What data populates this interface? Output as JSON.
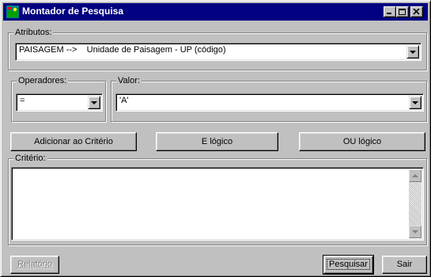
{
  "window": {
    "title": "Montador de Pesquisa",
    "app_icon": "map-search-icon",
    "controls": {
      "minimize": "minimize-icon",
      "maximize": "maximize-icon",
      "close": "close-icon"
    }
  },
  "atributos": {
    "label": "Atributos:",
    "value": "PAISAGEM -->    Unidade de Paisagem - UP (código)"
  },
  "operadores": {
    "label": "Operadores:",
    "value": "="
  },
  "valor": {
    "label": "Valor:",
    "value": "'A'"
  },
  "actions": {
    "add_label": "Adicionar ao Critério",
    "and_label": "E lógico",
    "or_label": "OU lógico"
  },
  "criterio": {
    "label": "Critério:",
    "text": ""
  },
  "footer": {
    "relatorio_label": "Relatório",
    "pesquisar_label": "Pesquisar",
    "sair_label": "Sair"
  },
  "colors": {
    "titlebar": "#000080",
    "face": "#c0c0c0",
    "field": "#ffffff"
  }
}
